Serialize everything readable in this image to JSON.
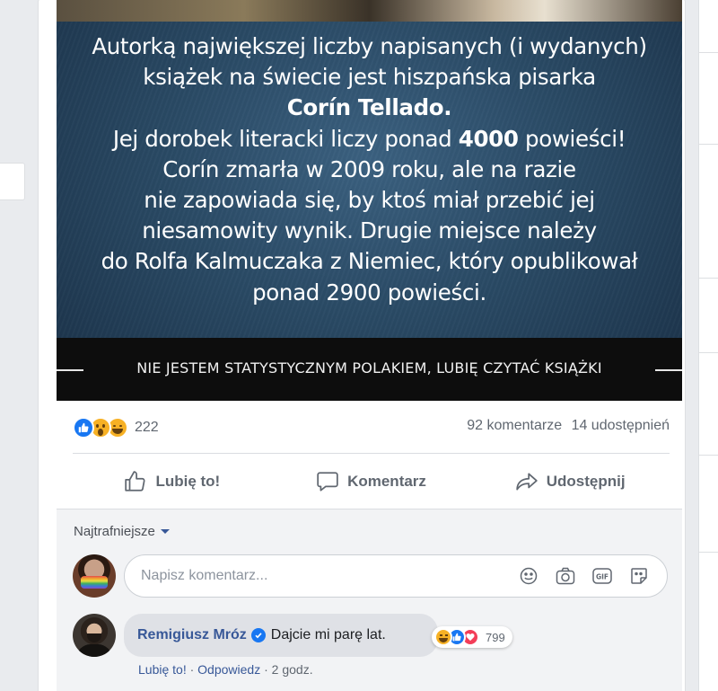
{
  "post": {
    "quote_lines": [
      {
        "parts": [
          {
            "t": "Autorką największej liczby napisanych (i wydanych)",
            "b": false
          }
        ]
      },
      {
        "parts": [
          {
            "t": "książek na świecie jest hiszpańska pisarka",
            "b": false
          }
        ]
      },
      {
        "parts": [
          {
            "t": "Corín Tellado.",
            "b": true
          }
        ]
      },
      {
        "parts": [
          {
            "t": "Jej dorobek literacki liczy ponad ",
            "b": false
          },
          {
            "t": "4000",
            "b": true
          },
          {
            "t": " powieści!",
            "b": false
          }
        ]
      },
      {
        "parts": [
          {
            "t": "Corín zmarła w 2009 roku, ale na razie",
            "b": false
          }
        ]
      },
      {
        "parts": [
          {
            "t": "nie zapowiada się, by ktoś miał przebić jej",
            "b": false
          }
        ]
      },
      {
        "parts": [
          {
            "t": "niesamowity wynik. Drugie miejsce należy",
            "b": false
          }
        ]
      },
      {
        "parts": [
          {
            "t": "do Rolfa Kalmuczaka z Niemiec, który opublikował",
            "b": false
          }
        ]
      },
      {
        "parts": [
          {
            "t": "ponad 2900 powieści.",
            "b": false
          }
        ]
      }
    ],
    "banner_text": "NIE JESTEM STATYSTYCZNYM POLAKIEM, LUBIĘ CZYTAĆ KSIĄŻKI"
  },
  "stats": {
    "reaction_icons": [
      "like-icon",
      "wow-icon",
      "haha-icon"
    ],
    "reaction_count": "222",
    "comments": "92 komentarze",
    "shares": "14 udostępnień"
  },
  "actions": {
    "like": "Lubię to!",
    "comment": "Komentarz",
    "share": "Udostępnij"
  },
  "comments": {
    "sort_label": "Najtrafniejsze",
    "input_placeholder": "Napisz komentarz...",
    "input_icons": [
      "emoji-icon",
      "camera-icon",
      "gif-icon",
      "sticker-icon"
    ],
    "items": [
      {
        "author": "Remigiusz Mróz",
        "verified": true,
        "text": "Dajcie mi parę lat.",
        "reaction_icons": [
          "haha-icon",
          "like-icon",
          "love-icon"
        ],
        "reaction_count": "799",
        "like_link": "Lubię to!",
        "reply_link": "Odpowiedz",
        "separator": " · ",
        "time": "2 godz."
      }
    ]
  },
  "colors": {
    "accent": "#1877f2",
    "link": "#385898",
    "muted": "#606770",
    "love": "#f33e58",
    "haha": "#f7b125"
  }
}
